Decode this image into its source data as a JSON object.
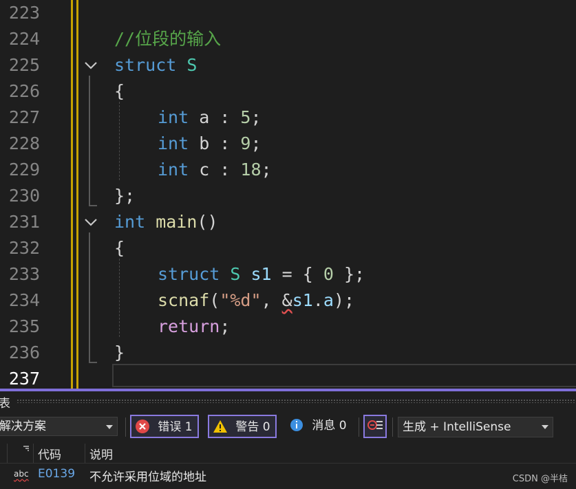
{
  "editor": {
    "line_numbers": [
      "223",
      "224",
      "225",
      "226",
      "227",
      "228",
      "229",
      "230",
      "231",
      "232",
      "233",
      "234",
      "235",
      "236",
      "237"
    ],
    "current_line": "237",
    "code": {
      "l224_comment": "//位段的输入",
      "l225_kw": "struct",
      "l225_name": "S",
      "l226": "{",
      "l227_kw": "int",
      "l227_rest": " a : ",
      "l227_num": "5",
      "l227_end": ";",
      "l228_kw": "int",
      "l228_rest": " b : ",
      "l228_num": "9",
      "l228_end": ";",
      "l229_kw": "int",
      "l229_rest": " c : ",
      "l229_num": "18",
      "l229_end": ";",
      "l230": "};",
      "l231_kw": "int",
      "l231_fn": " main",
      "l231_rest": "()",
      "l232": "{",
      "l233_kw": "struct",
      "l233_ty": " S",
      "l233_var": " s1",
      "l233_mid": " = { ",
      "l233_num": "0",
      "l233_end": " };",
      "l234_fn": "scnaf",
      "l234_open": "(",
      "l234_str": "\"%d\"",
      "l234_comma": ", ",
      "l234_amp": "&",
      "l234_var": "s1",
      "l234_dot": ".",
      "l234_mem": "a",
      "l234_end": ");",
      "l235_kw": "return",
      "l235_end": ";",
      "l236": "}"
    }
  },
  "panel": {
    "title": "表",
    "scope": "解决方案",
    "errors_label": "错误 1",
    "warnings_label": "警告 0",
    "messages_label": "消息 0",
    "build_filter": "生成 + IntelliSense",
    "columns": {
      "code": "代码",
      "description": "说明"
    },
    "rows": [
      {
        "icon": "abc",
        "code": "E0139",
        "description": "不允许采用位域的地址"
      }
    ]
  },
  "watermark": "CSDN @半桔",
  "colors": {
    "accent": "#7f6fd9",
    "error": "#e04848",
    "warning": "#f0c000",
    "info": "#3c8fe0"
  }
}
